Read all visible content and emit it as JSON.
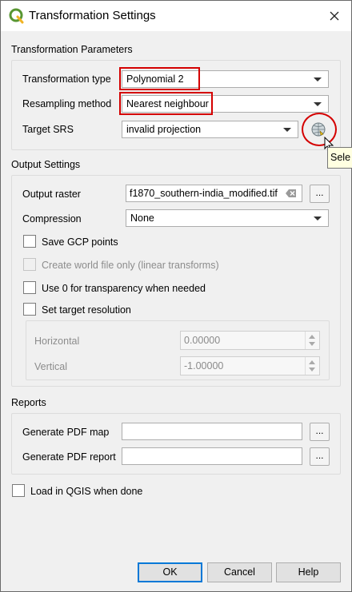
{
  "window": {
    "title": "Transformation Settings"
  },
  "sections": {
    "transformation": "Transformation Parameters",
    "output": "Output Settings",
    "reports": "Reports"
  },
  "transformation": {
    "type_label": "Transformation type",
    "type_value": "Polynomial 2",
    "resampling_label": "Resampling method",
    "resampling_value": "Nearest neighbour",
    "srs_label": "Target SRS",
    "srs_value": "invalid projection",
    "tooltip": "Sele"
  },
  "output": {
    "raster_label": "Output raster",
    "raster_value": "f1870_southern-india_modified.tif",
    "browse": "...",
    "compression_label": "Compression",
    "compression_value": "None",
    "save_gcp": "Save GCP points",
    "world_file": "Create world file only (linear transforms)",
    "use_zero": "Use 0 for transparency when needed",
    "set_resolution": "Set target resolution",
    "horizontal_label": "Horizontal",
    "horizontal_value": "0.00000",
    "vertical_label": "Vertical",
    "vertical_value": "-1.00000"
  },
  "reports": {
    "pdf_map_label": "Generate PDF map",
    "pdf_report_label": "Generate PDF report",
    "browse": "..."
  },
  "load_in_qgis": "Load in QGIS when done",
  "buttons": {
    "ok": "OK",
    "cancel": "Cancel",
    "help": "Help"
  },
  "colors": {
    "highlight": "#d40000",
    "default_button_border": "#0078d7",
    "qgis_green": "#589632"
  }
}
